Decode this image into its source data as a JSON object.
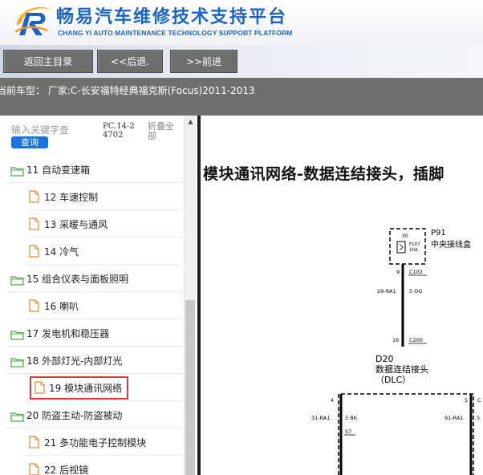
{
  "header": {
    "title_cn": "畅易汽车维修技术支持平台",
    "title_en": "CHANG YI AUTO MAINTENANCE TECHNOLOGY SUPPORT PLATFORM"
  },
  "nav": {
    "home_label": "返回主目录",
    "back_label": "<<后退.",
    "forward_label": ">>前进"
  },
  "model_bar": {
    "text": "当前车型： 厂家:C-长安福特经典福克斯(Focus)2011-2013"
  },
  "sidebar": {
    "search_placeholder": "输入关键字查",
    "search_button": "查询",
    "pc_code": "PC.14-24702",
    "collapse_all": "折叠全部",
    "items": [
      {
        "type": "folder",
        "label": "11 自动变速箱"
      },
      {
        "type": "file",
        "label": "12 车速控制"
      },
      {
        "type": "file",
        "label": "13 采暖与通风"
      },
      {
        "type": "file",
        "label": "14 冷气"
      },
      {
        "type": "folder",
        "label": "15 组合仪表与面板照明"
      },
      {
        "type": "file",
        "label": "16 喇叭"
      },
      {
        "type": "folder",
        "label": "17 发电机和稳压器"
      },
      {
        "type": "folder",
        "label": "18 外部灯光-内部灯光"
      },
      {
        "type": "file",
        "label": "19 模块通讯网络",
        "selected": true
      },
      {
        "type": "folder",
        "label": "20 防盗主动-防盗被动"
      },
      {
        "type": "file",
        "label": "21 多功能电子控制模块"
      },
      {
        "type": "file",
        "label": "22 后视镜"
      }
    ]
  },
  "content": {
    "title": "模块通讯网络-数据连结接头，插脚",
    "diagram": {
      "p91_label": "P91",
      "p91_desc": "中央接线盒",
      "fuse_num": "30",
      "fuse_id": "F107",
      "fuse_amp": "10A",
      "pin_9": "9",
      "conn_c102": "C102",
      "wire_29ra1": "29-RA1",
      "wire_5og": ".5 OG",
      "pin_16": "16",
      "conn_c200": "C200",
      "d20_label": "D20",
      "d20_desc": "数据连结接头",
      "dlc": "（DLC）",
      "pin_4": "4",
      "pin_5": "5",
      "conn_c_right": "C",
      "wire_31ra1": "31-RA1",
      "wire_5bk": ".5 BK",
      "splice_s7": "S7",
      "wire_91ra1": "91-RA1",
      "wire_5_right": ".5"
    }
  },
  "colors": {
    "brand_blue": "#1b63c4",
    "nav_button": "#6e6e6e",
    "model_bar": "#6f6f6f",
    "search_button": "#1a73d9",
    "folder_icon": "#4aa84a",
    "file_icon": "#e08a2c",
    "selected_border": "#e03a3a"
  }
}
